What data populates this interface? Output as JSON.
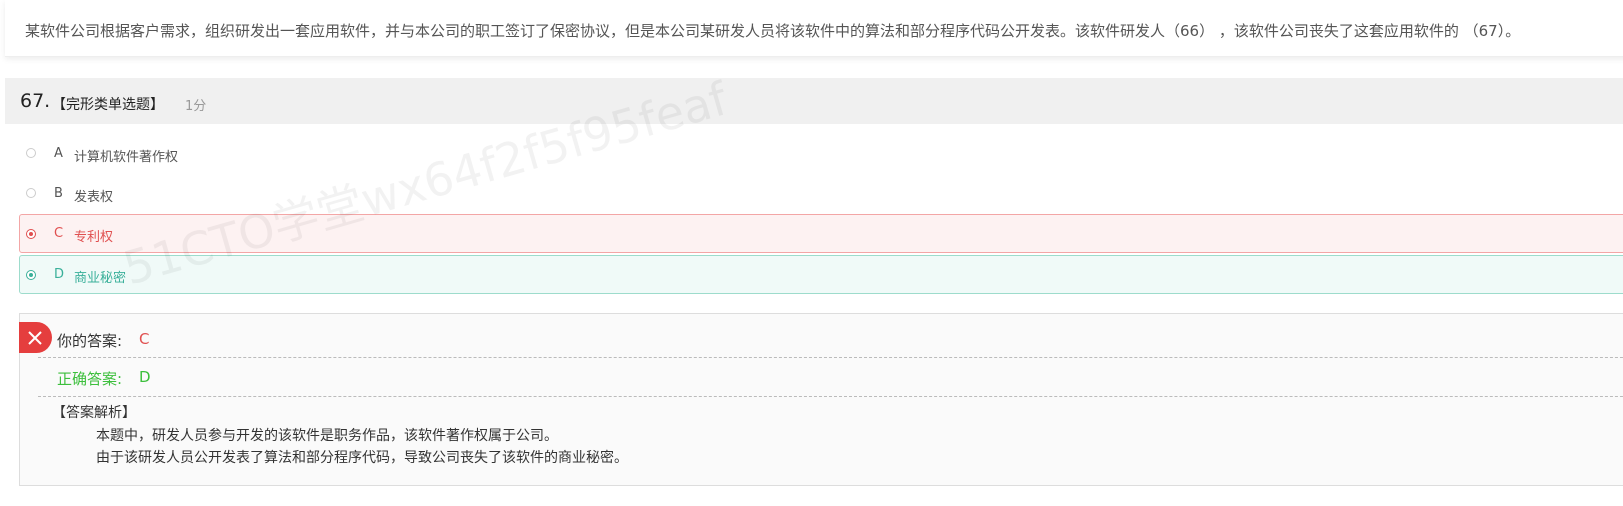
{
  "question": {
    "stem": "某软件公司根据客户需求，组织研发出一套应用软件，并与本公司的职工签订了保密协议，但是本公司某研发人员将该软件中的算法和部分程序代码公开发表。该软件研发人（66） ，该软件公司丧失了这套应用软件的 （67）。",
    "number": "67.",
    "type": "【完形类单选题】",
    "score": "1分"
  },
  "options": [
    {
      "letter": "A",
      "text": "计算机软件著作权",
      "state": "none"
    },
    {
      "letter": "B",
      "text": "发表权",
      "state": "none"
    },
    {
      "letter": "C",
      "text": "专利权",
      "state": "wrong"
    },
    {
      "letter": "D",
      "text": "商业秘密",
      "state": "correct"
    }
  ],
  "answer": {
    "your_label": "你的答案:",
    "your_value": "C",
    "correct_label": "正确答案:",
    "correct_value": "D",
    "analysis_title": "【答案解析】",
    "analysis_lines": [
      "本题中，研发人员参与开发的该软件是职务作品，该软件著作权属于公司。",
      "由于该研发人员公开发表了算法和部分程序代码，导致公司丧失了该软件的商业秘密。"
    ]
  },
  "watermark": "51CTO学堂wx64f2f5f95feaf",
  "icons": {
    "wrong_badge": "close-icon"
  },
  "colors": {
    "wrong": "#e05050",
    "correct_option": "#3ab09a",
    "correct_answer": "#3cbf3c",
    "badge": "#e53e3e"
  }
}
